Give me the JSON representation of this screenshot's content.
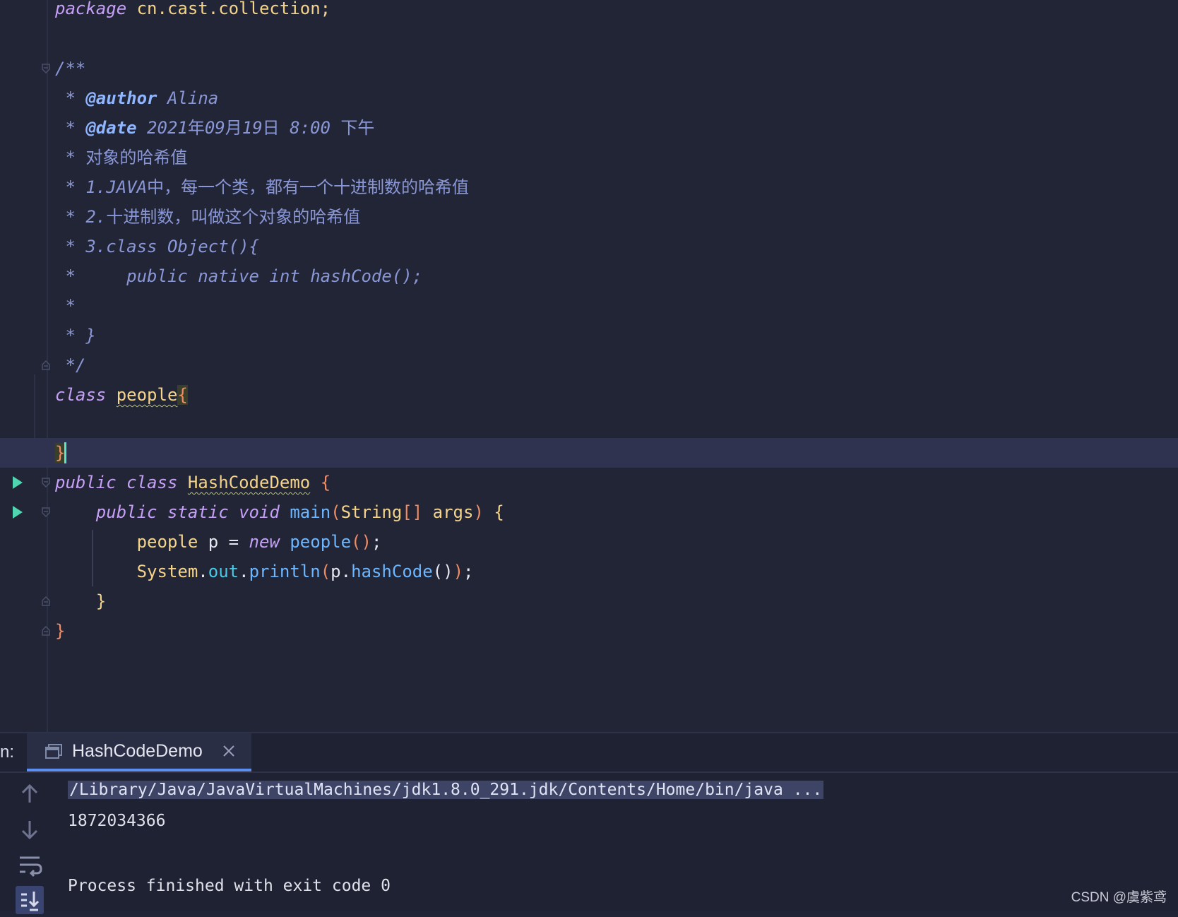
{
  "editor": {
    "lines": [
      {
        "id": "l0",
        "segments": [
          {
            "cls": "kw",
            "text": "package "
          },
          {
            "cls": "pkgname",
            "text": "cn.cast.collection;"
          }
        ]
      },
      {
        "id": "l1",
        "segments": []
      },
      {
        "id": "l2",
        "segments": [
          {
            "cls": "doc",
            "text": "/**"
          }
        ]
      },
      {
        "id": "l3",
        "segments": [
          {
            "cls": "doc",
            "text": " * "
          },
          {
            "cls": "doctag",
            "text": "@author"
          },
          {
            "cls": "doc",
            "text": " Alina"
          }
        ]
      },
      {
        "id": "l4",
        "segments": [
          {
            "cls": "doc",
            "text": " * "
          },
          {
            "cls": "doctag",
            "text": "@date"
          },
          {
            "cls": "doc",
            "text": " 2021"
          },
          {
            "cls": "doccjk",
            "text": "年"
          },
          {
            "cls": "doc",
            "text": "09"
          },
          {
            "cls": "doccjk",
            "text": "月"
          },
          {
            "cls": "doc",
            "text": "19"
          },
          {
            "cls": "doccjk",
            "text": "日"
          },
          {
            "cls": "doc",
            "text": " 8:00 "
          },
          {
            "cls": "doccjk",
            "text": "下午"
          }
        ]
      },
      {
        "id": "l5",
        "segments": [
          {
            "cls": "doc",
            "text": " * "
          },
          {
            "cls": "doccjk",
            "text": "对象的哈希值"
          }
        ]
      },
      {
        "id": "l6",
        "segments": [
          {
            "cls": "doc",
            "text": " * 1.JAVA"
          },
          {
            "cls": "doccjk",
            "text": "中，每一个类，都有一个十进制数的哈希值"
          }
        ]
      },
      {
        "id": "l7",
        "segments": [
          {
            "cls": "doc",
            "text": " * 2."
          },
          {
            "cls": "doccjk",
            "text": "十进制数，叫做这个对象的哈希值"
          }
        ]
      },
      {
        "id": "l8",
        "segments": [
          {
            "cls": "doc",
            "text": " * 3.class Object(){"
          }
        ]
      },
      {
        "id": "l9",
        "segments": [
          {
            "cls": "doc",
            "text": " *     public native int hashCode();"
          }
        ]
      },
      {
        "id": "l10",
        "segments": [
          {
            "cls": "doc",
            "text": " *"
          }
        ]
      },
      {
        "id": "l11",
        "segments": [
          {
            "cls": "doc",
            "text": " * }"
          }
        ]
      },
      {
        "id": "l12",
        "segments": [
          {
            "cls": "doc",
            "text": " */"
          }
        ]
      },
      {
        "id": "l13",
        "segments": [
          {
            "cls": "kw",
            "text": "class "
          },
          {
            "cls": "cls squig",
            "text": "people"
          },
          {
            "cls": "bracehl",
            "text": "{"
          }
        ]
      },
      {
        "id": "l14",
        "segments": []
      },
      {
        "id": "l15",
        "segments": [
          {
            "cls": "bracehl",
            "text": "}"
          }
        ]
      },
      {
        "id": "l16",
        "segments": [
          {
            "cls": "kw",
            "text": "public class "
          },
          {
            "cls": "cls squig",
            "text": "HashCodeDemo"
          },
          {
            "cls": "plain",
            "text": " "
          },
          {
            "cls": "brace",
            "text": "{"
          }
        ]
      },
      {
        "id": "l17",
        "segments": [
          {
            "cls": "plain",
            "text": "    "
          },
          {
            "cls": "kw",
            "text": "public static void "
          },
          {
            "cls": "fn",
            "text": "main"
          },
          {
            "cls": "brace",
            "text": "("
          },
          {
            "cls": "cls",
            "text": "String"
          },
          {
            "cls": "brace",
            "text": "[]"
          },
          {
            "cls": "plain",
            "text": " "
          },
          {
            "cls": "cls",
            "text": "args"
          },
          {
            "cls": "brace",
            "text": ")"
          },
          {
            "cls": "plain",
            "text": " "
          },
          {
            "cls": "cls",
            "text": "{"
          }
        ]
      },
      {
        "id": "l18",
        "segments": [
          {
            "cls": "plain",
            "text": "        "
          },
          {
            "cls": "cls",
            "text": "people"
          },
          {
            "cls": "plain",
            "text": " p = "
          },
          {
            "cls": "kw",
            "text": "new "
          },
          {
            "cls": "fn",
            "text": "people"
          },
          {
            "cls": "brace",
            "text": "()"
          },
          {
            "cls": "plain",
            "text": ";"
          }
        ]
      },
      {
        "id": "l19",
        "segments": [
          {
            "cls": "plain",
            "text": "        "
          },
          {
            "cls": "cls",
            "text": "System"
          },
          {
            "cls": "plain",
            "text": "."
          },
          {
            "cls": "field",
            "text": "out"
          },
          {
            "cls": "plain",
            "text": "."
          },
          {
            "cls": "fn",
            "text": "println"
          },
          {
            "cls": "brace",
            "text": "("
          },
          {
            "cls": "plain",
            "text": "p."
          },
          {
            "cls": "fn",
            "text": "hashCode"
          },
          {
            "cls": "plain",
            "text": "()"
          },
          {
            "cls": "brace",
            "text": ")"
          },
          {
            "cls": "plain",
            "text": ";"
          }
        ]
      },
      {
        "id": "l20",
        "segments": [
          {
            "cls": "plain",
            "text": "    "
          },
          {
            "cls": "cls",
            "text": "}"
          }
        ]
      },
      {
        "id": "l21",
        "segments": [
          {
            "cls": "brace",
            "text": "}"
          }
        ]
      }
    ]
  },
  "run_panel": {
    "label": "n:",
    "tab_label": "HashCodeDemo",
    "console_lines": [
      "/Library/Java/JavaVirtualMachines/jdk1.8.0_291.jdk/Contents/Home/bin/java ...",
      "1872034366",
      "",
      "Process finished with exit code 0"
    ]
  },
  "watermark": "CSDN @虞紫鸢",
  "colors": {
    "background": "#222536",
    "current_line": "#2f3350",
    "keyword": "#c6a0f6",
    "class": "#f5d48a",
    "function": "#6cb6ff",
    "doc": "#8a97d6",
    "tab_underline": "#5d8ff0"
  }
}
